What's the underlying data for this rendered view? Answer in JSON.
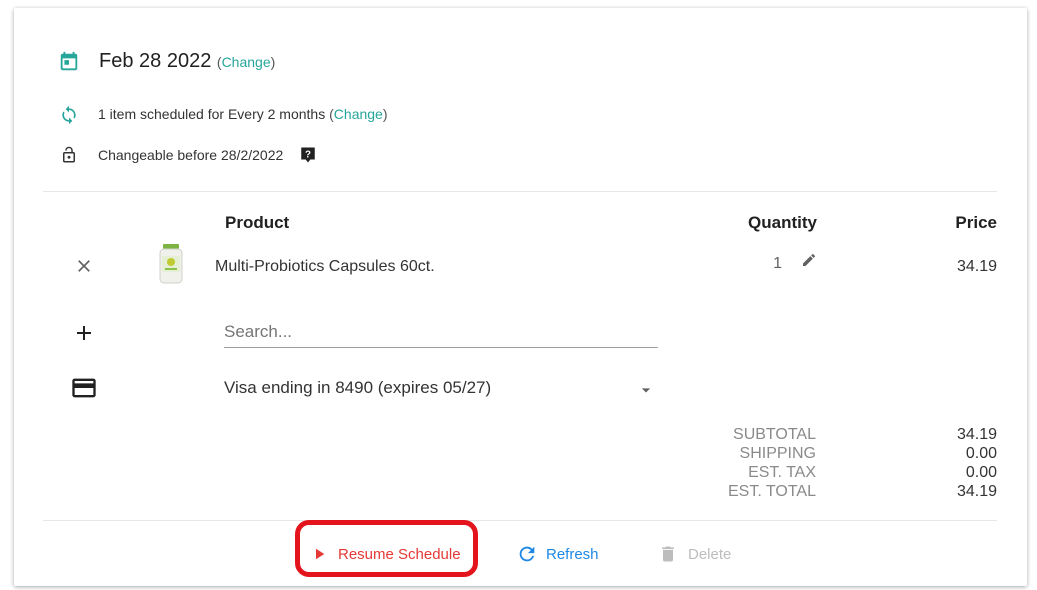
{
  "schedule": {
    "date": "Feb 28 2022",
    "date_change_link": "Change",
    "frequency_text": "1 item scheduled for Every 2 months",
    "frequency_change_link": "Change",
    "changeable_text": "Changeable before 28/2/2022",
    "help_icon": "question-icon"
  },
  "table": {
    "headers": {
      "product": "Product",
      "quantity": "Quantity",
      "price": "Price"
    },
    "rows": [
      {
        "product": "Multi-Probiotics Capsules 60ct.",
        "quantity": "1",
        "price": "34.19"
      }
    ]
  },
  "search": {
    "placeholder": "Search..."
  },
  "payment": {
    "selected": "Visa ending in 8490 (expires 05/27)"
  },
  "totals": {
    "subtotal_label": "SUBTOTAL",
    "subtotal": "34.19",
    "shipping_label": "SHIPPING",
    "shipping": "0.00",
    "tax_label": "EST. TAX",
    "tax": "0.00",
    "total_label": "EST. TOTAL",
    "total": "34.19"
  },
  "actions": {
    "resume": "Resume Schedule",
    "refresh": "Refresh",
    "delete": "Delete"
  },
  "colors": {
    "accent_teal": "#26a69a",
    "resume_red": "#e53935",
    "refresh_blue": "#1e88e5",
    "disabled_gray": "#bdbdbd",
    "annotation_red": "#e3141b"
  }
}
